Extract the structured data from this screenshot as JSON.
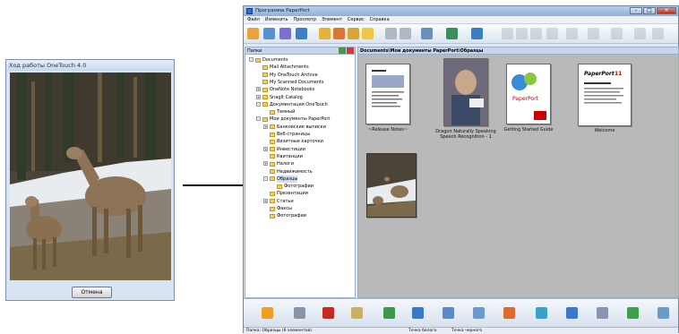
{
  "dialog": {
    "title": "Ход работы OneTouch 4.0",
    "cancel_label": "Отмена"
  },
  "window": {
    "title": "Программа PaperPort",
    "menu": [
      "Файл",
      "Изменить",
      "Просмотр",
      "Элемент",
      "Сервис",
      "Справка"
    ],
    "folders_header": "Папки",
    "path": "Documents\\Мои документы PaperPort\\Образцы",
    "tree": [
      {
        "label": "Documents",
        "level": 0,
        "exp": "-"
      },
      {
        "label": "Mail Attachments",
        "level": 1
      },
      {
        "label": "My OneTouch Archive",
        "level": 1
      },
      {
        "label": "My Scanned Documents",
        "level": 1
      },
      {
        "label": "OneNote Notebooks",
        "level": 1,
        "exp": "+"
      },
      {
        "label": "SnagIt Catalog",
        "level": 1,
        "exp": "+"
      },
      {
        "label": "Документация OneTouch",
        "level": 1,
        "exp": "-"
      },
      {
        "label": "Темный",
        "level": 2
      },
      {
        "label": "Мои документы PaperPort",
        "level": 1,
        "exp": "-"
      },
      {
        "label": "Банковские выписки",
        "level": 2,
        "exp": "+"
      },
      {
        "label": "Веб-страницы",
        "level": 2
      },
      {
        "label": "Визитные карточки",
        "level": 2
      },
      {
        "label": "Инвестиции",
        "level": 2,
        "exp": "+"
      },
      {
        "label": "Квитанции",
        "level": 2
      },
      {
        "label": "Налоги",
        "level": 2,
        "exp": "+"
      },
      {
        "label": "Недвижимость",
        "level": 2
      },
      {
        "label": "Образцы",
        "level": 2,
        "exp": "-",
        "selected": true
      },
      {
        "label": "Фотографии",
        "level": 3
      },
      {
        "label": "Презентации",
        "level": 2
      },
      {
        "label": "Статьи",
        "level": 2,
        "exp": "+"
      },
      {
        "label": "Факсы",
        "level": 2
      },
      {
        "label": "Фотографии",
        "level": 2
      }
    ],
    "items": [
      {
        "caption": "~Release Notes~"
      },
      {
        "caption": "Dragon Naturally Speaking Speech Recognition - 1"
      },
      {
        "caption": "Getting Started Guide"
      },
      {
        "caption": "Welcome"
      },
      {
        "caption": ""
      }
    ],
    "doc_brand": "PaperPort 11",
    "status": {
      "left": "Папка: Образцы (6 элементов)",
      "mid": "Точка белого",
      "right": "Точка черного"
    }
  }
}
